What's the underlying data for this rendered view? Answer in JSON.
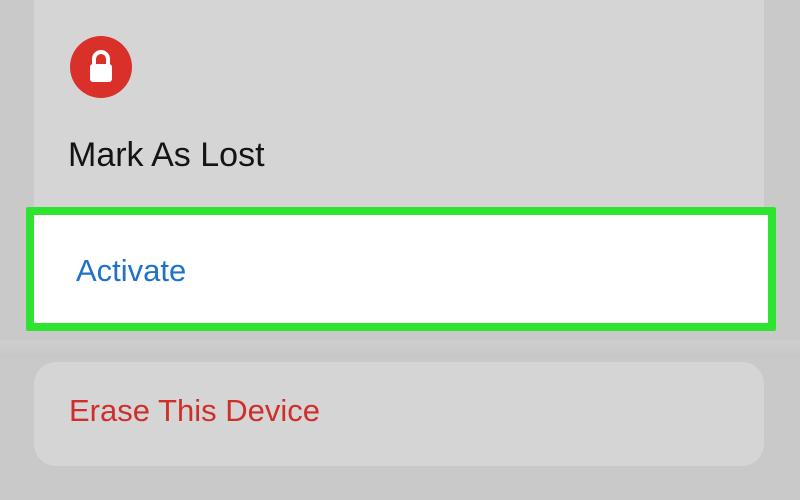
{
  "icons": {
    "lock": "lock-icon"
  },
  "colors": {
    "page_background": "#c9c9c9",
    "card_background": "#d5d5d5",
    "lock_badge": "#d9302a",
    "activate_text": "#1f72c6",
    "erase_text": "#cf2f2a",
    "highlight_border": "#2fe331"
  },
  "section": {
    "title": "Mark As Lost",
    "activate_label": "Activate",
    "erase_label": "Erase This Device"
  }
}
